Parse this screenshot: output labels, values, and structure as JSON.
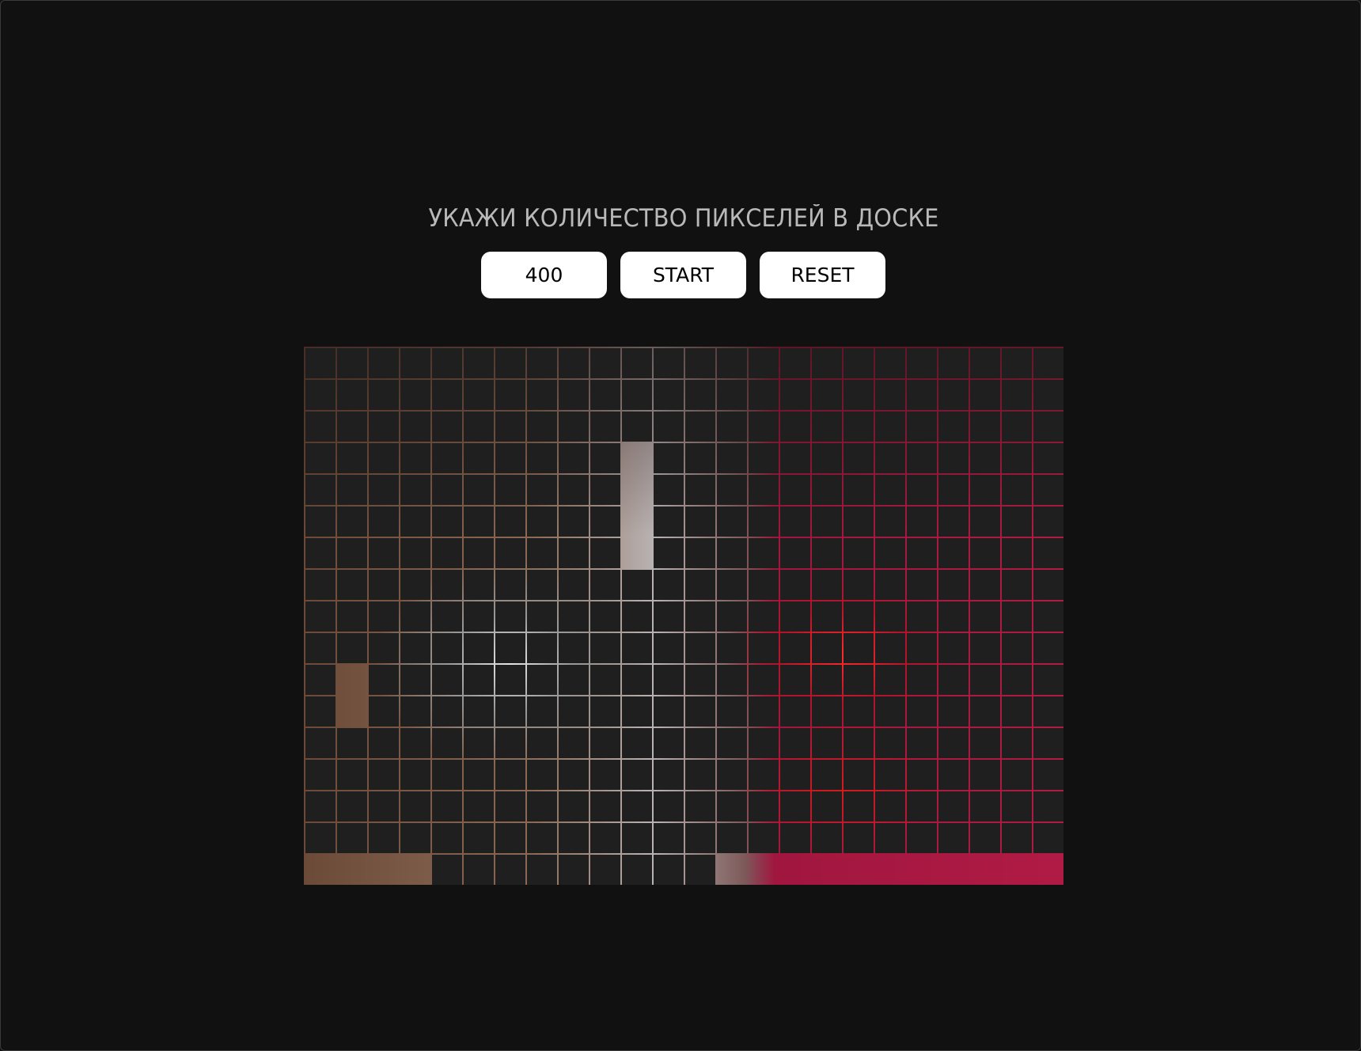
{
  "title": "УКАЖИ КОЛИЧЕСТВО ПИКСЕЛЕЙ В ДОСКЕ",
  "controls": {
    "pixel_count_value": "400",
    "start_label": "START",
    "reset_label": "RESET"
  },
  "board": {
    "columns": 24,
    "rows": 17,
    "revealed_cells": [
      [
        3,
        10
      ],
      [
        4,
        10
      ],
      [
        5,
        10
      ],
      [
        6,
        10
      ],
      [
        10,
        1
      ],
      [
        11,
        1
      ],
      [
        16,
        0
      ],
      [
        16,
        1
      ],
      [
        16,
        2
      ],
      [
        16,
        3
      ],
      [
        16,
        13
      ],
      [
        16,
        14
      ],
      [
        16,
        15
      ],
      [
        16,
        16
      ],
      [
        16,
        17
      ],
      [
        16,
        18
      ],
      [
        16,
        19
      ],
      [
        16,
        20
      ],
      [
        16,
        21
      ],
      [
        16,
        22
      ],
      [
        16,
        23
      ]
    ],
    "cell_color": "#1f1f1f"
  }
}
